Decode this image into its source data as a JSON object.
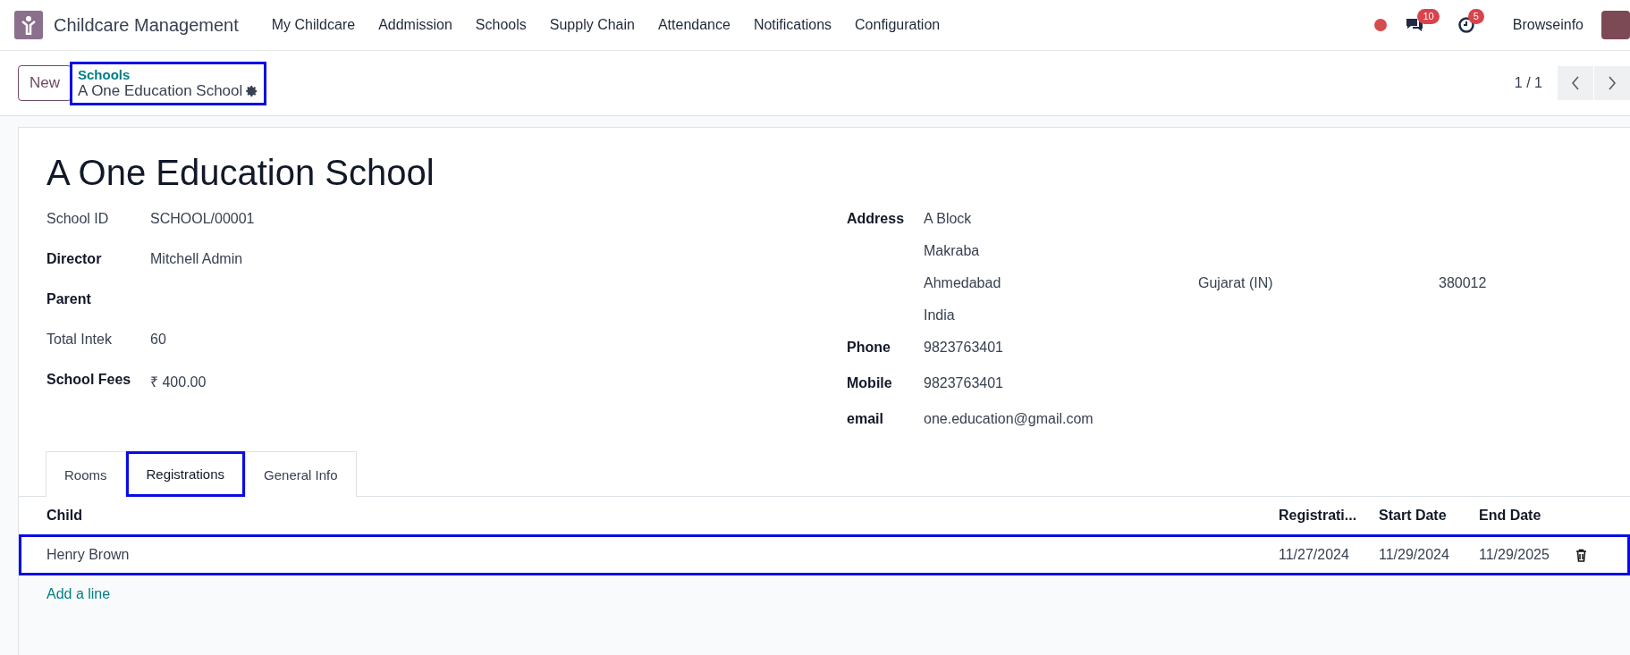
{
  "navbar": {
    "app_name": "Childcare Management",
    "menu": [
      "My Childcare",
      "Addmission",
      "Schools",
      "Supply Chain",
      "Attendance",
      "Notifications",
      "Configuration"
    ],
    "chat_badge": "10",
    "activity_badge": "5",
    "user": "Browseinfo"
  },
  "control_panel": {
    "new_button": "New",
    "breadcrumb": {
      "parent": "Schools",
      "current": "A One Education School",
      "highlighted": true
    },
    "pager": "1 / 1"
  },
  "form": {
    "title": "A One Education School",
    "left_fields": [
      {
        "label": "School ID",
        "value": "SCHOOL/00001",
        "required": false
      },
      {
        "label": "Director",
        "value": "Mitchell Admin",
        "required": true
      },
      {
        "label": "Parent",
        "required": true
      },
      {
        "label": "Total Intek",
        "value": "60",
        "required": false
      },
      {
        "label": "School Fees",
        "value": "₹ 400.00",
        "required": true
      }
    ],
    "address": {
      "label": "Address",
      "street": "A Block",
      "street2": "Makraba",
      "city": "Ahmedabad",
      "state": "Gujarat (IN)",
      "zip": "380012",
      "country": "India"
    },
    "right_fields": [
      {
        "label": "Phone",
        "value": "9823763401",
        "required": true
      },
      {
        "label": "Mobile",
        "value": "9823763401",
        "required": true
      },
      {
        "label": "email",
        "value": "one.education@gmail.com",
        "required": true
      }
    ]
  },
  "tabs": [
    {
      "label": "Rooms",
      "selected": false,
      "highlighted": false
    },
    {
      "label": "Registrations",
      "selected": true,
      "highlighted": true
    },
    {
      "label": "General Info",
      "selected": false,
      "highlighted": false
    }
  ],
  "table": {
    "columns": [
      "Child",
      "Registrati...",
      "Start Date",
      "End Date"
    ],
    "rows": [
      {
        "cells": [
          "Henry Brown",
          "11/27/2024",
          "11/29/2024",
          "11/29/2025"
        ],
        "highlighted": true
      }
    ],
    "add_line": "Add a line"
  }
}
